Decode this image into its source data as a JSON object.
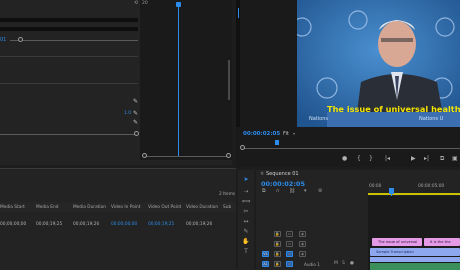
{
  "effect_controls": {
    "ruler_label": "20",
    "value_a": "01",
    "value_b": "1.0"
  },
  "program_monitor": {
    "caption": "The issue of universal health",
    "timecode": "00:00:02:05",
    "fit": "Fit",
    "podium_text_left": "Nations",
    "podium_text_right": "Nations U"
  },
  "project_panel": {
    "item_count": "2 Items",
    "columns": [
      "Media Start",
      "Media End",
      "Media Duration",
      "Video In Point",
      "Video Out Point",
      "Video Duration",
      "Sub"
    ],
    "row": [
      "00;00;00;00",
      "00;00;19;25",
      "00;00;19;26",
      "00;00;00;00",
      "00;00;19;25",
      "00;00;19;26"
    ]
  },
  "timeline": {
    "tab_label": "Sequence 01",
    "timecode": "00:00:02:05",
    "ruler_start": "00:00",
    "ruler_mid": "00:00:05:00",
    "track_v1": "V1",
    "track_a1": "A1",
    "audio_label": "Audio 1",
    "clips": {
      "c1": "The issue of universal",
      "c2": "It is the the",
      "c3": "Sample Transcription"
    }
  },
  "colors": {
    "accent": "#2d8ceb",
    "caption_yellow": "#f5e400",
    "clip_pink": "#e59ae8",
    "clip_blue": "#8ea8f0",
    "audio_green": "#3a8f5a"
  }
}
